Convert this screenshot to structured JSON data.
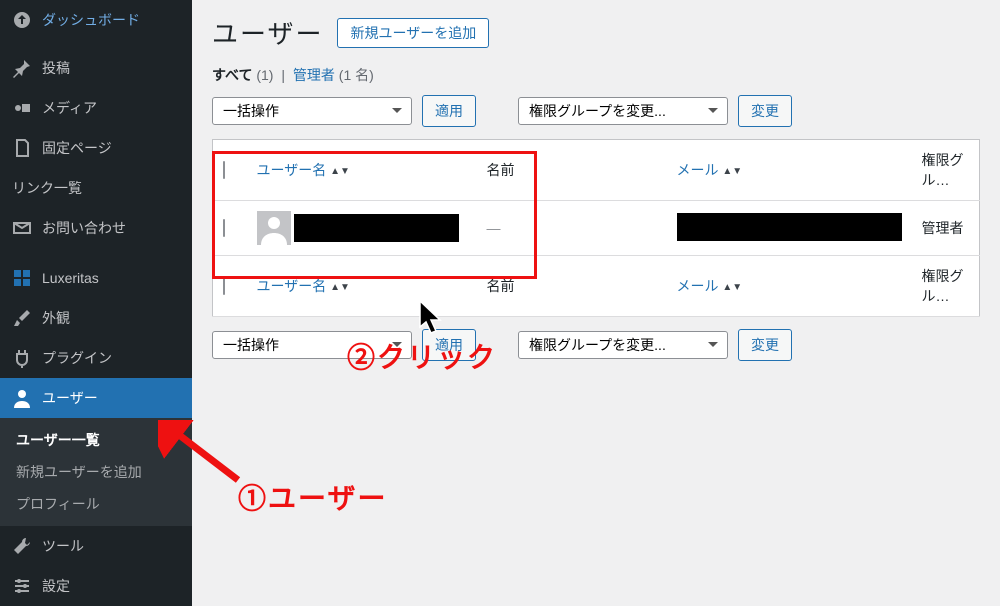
{
  "sidebar": {
    "items": [
      {
        "icon": "dashboard",
        "label": "ダッシュボード"
      },
      {
        "icon": "post",
        "label": "投稿"
      },
      {
        "icon": "media",
        "label": "メディア"
      },
      {
        "icon": "page",
        "label": "固定ページ"
      },
      {
        "icon": "",
        "label": "リンク一覧"
      },
      {
        "icon": "mail",
        "label": "お問い合わせ"
      },
      {
        "icon": "luxeritas",
        "label": "Luxeritas"
      },
      {
        "icon": "appearance",
        "label": "外観"
      },
      {
        "icon": "plugin",
        "label": "プラグイン"
      },
      {
        "icon": "user",
        "label": "ユーザー"
      },
      {
        "icon": "tool",
        "label": "ツール"
      },
      {
        "icon": "settings",
        "label": "設定"
      }
    ],
    "submenu": {
      "items": [
        {
          "label": "ユーザー一覧",
          "selected": true
        },
        {
          "label": "新規ユーザーを追加",
          "selected": false
        },
        {
          "label": "プロフィール",
          "selected": false
        }
      ]
    }
  },
  "header": {
    "title": "ユーザー",
    "add_new": "新規ユーザーを追加"
  },
  "filters": {
    "all_label": "すべて",
    "all_count": "(1)",
    "admin_label": "管理者",
    "admin_count": "(1 名)"
  },
  "bulk": {
    "action_placeholder": "一括操作",
    "apply": "適用",
    "role_placeholder": "権限グループを変更...",
    "change": "変更"
  },
  "table": {
    "col_username": "ユーザー名",
    "col_name": "名前",
    "col_email": "メール",
    "col_role": "権限グル…",
    "rows": [
      {
        "name_dash": "—",
        "role": "管理者"
      }
    ]
  },
  "annotations": {
    "step1": "①ユーザー",
    "step2": "②クリック"
  }
}
